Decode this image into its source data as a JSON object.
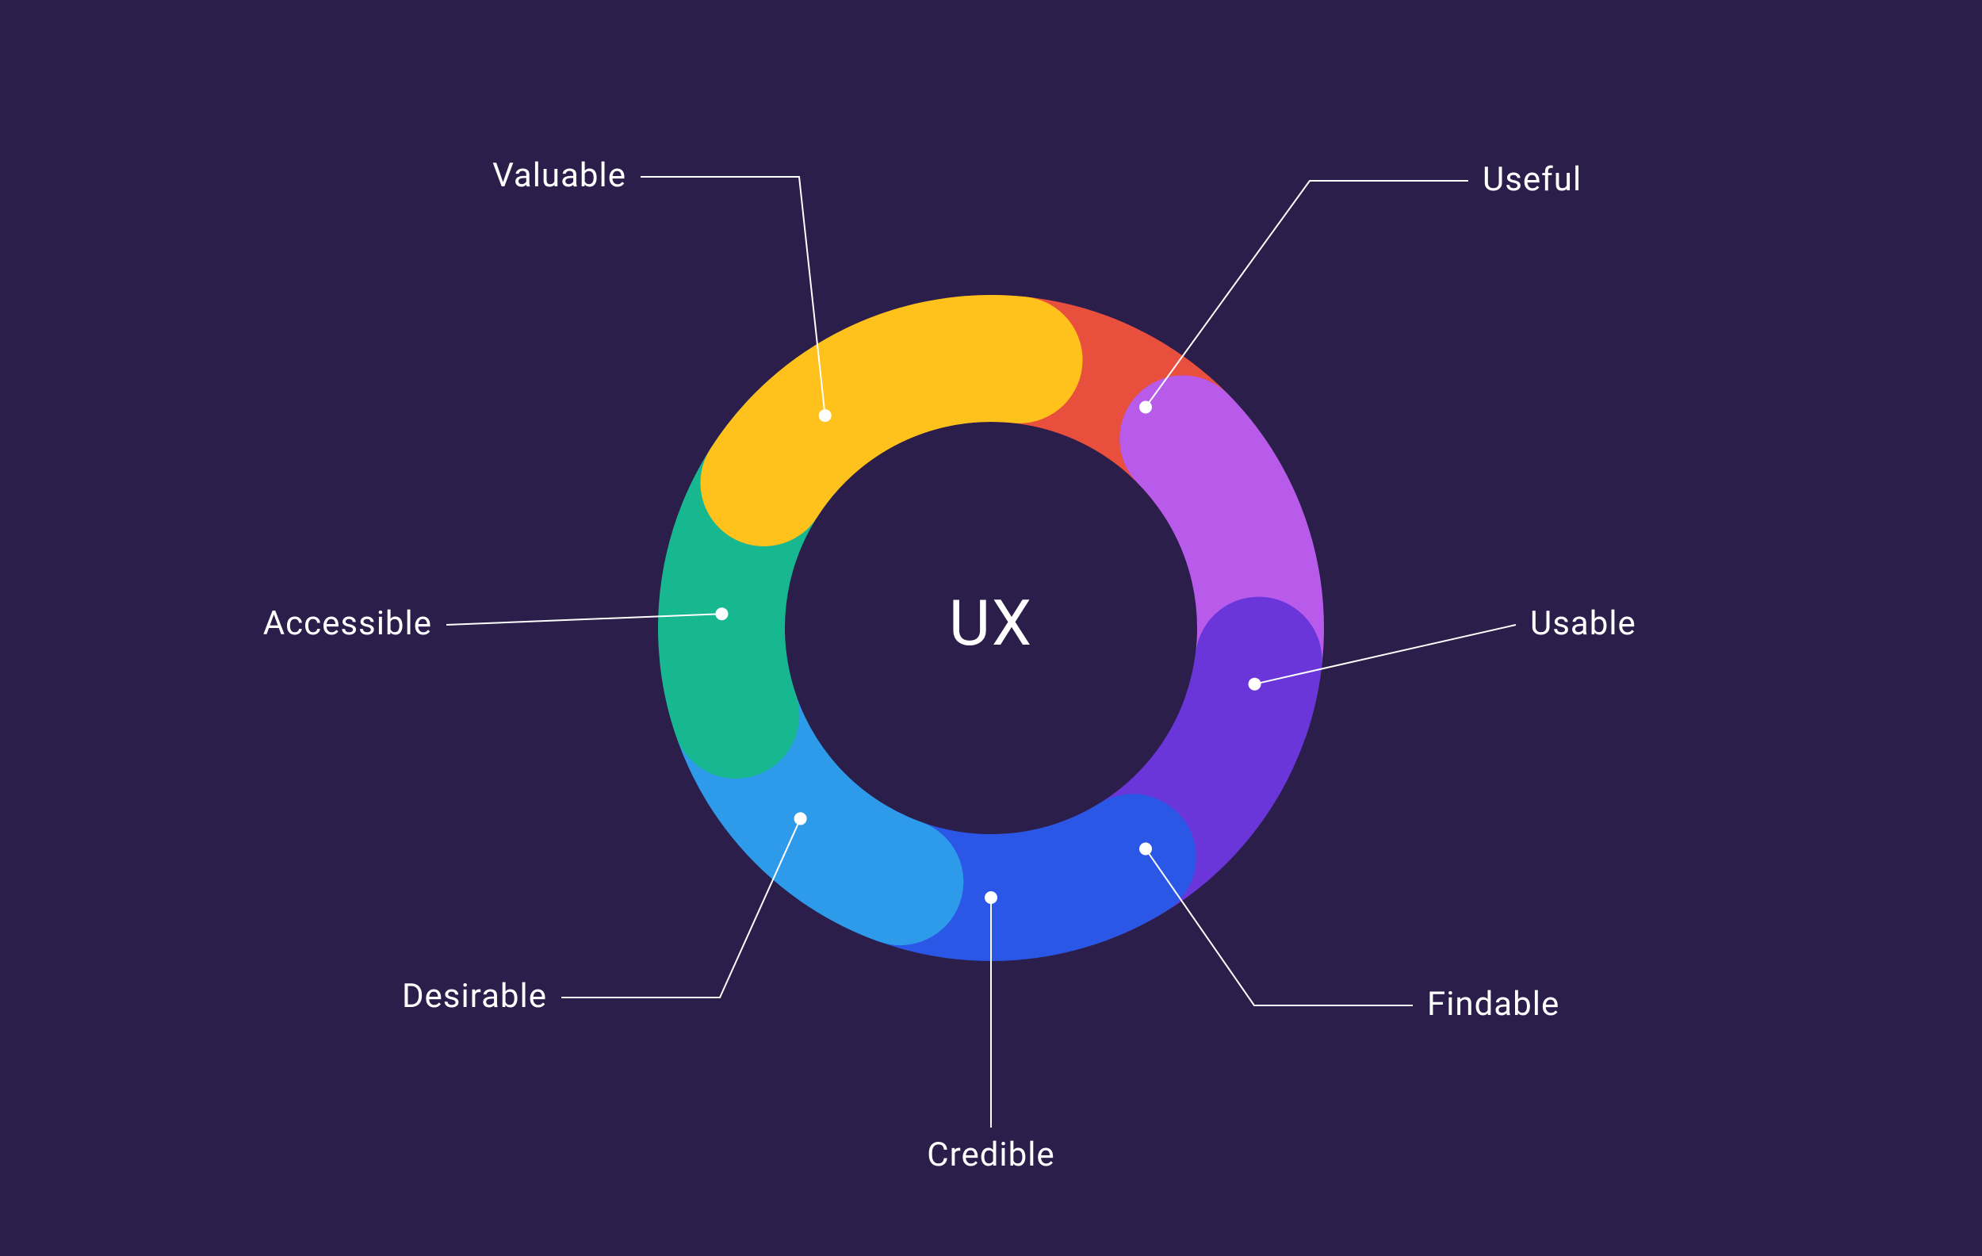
{
  "chart_data": {
    "type": "pie",
    "title": "UX",
    "series": [
      {
        "name": "Useful",
        "value": 1,
        "color": "#e84f3d"
      },
      {
        "name": "Usable",
        "value": 1,
        "color": "#b85beb"
      },
      {
        "name": "Findable",
        "value": 1,
        "color": "#6a36d9"
      },
      {
        "name": "Credible",
        "value": 1,
        "color": "#2b57e6"
      },
      {
        "name": "Desirable",
        "value": 1,
        "color": "#2e9bea"
      },
      {
        "name": "Accessible",
        "value": 1,
        "color": "#17b890"
      },
      {
        "name": "Valuable",
        "value": 1,
        "color": "#ffc21c"
      }
    ]
  },
  "center_label": "UX",
  "segments": {
    "useful": {
      "label": "Useful"
    },
    "usable": {
      "label": "Usable"
    },
    "findable": {
      "label": "Findable"
    },
    "credible": {
      "label": "Credible"
    },
    "desirable": {
      "label": "Desirable"
    },
    "accessible": {
      "label": "Accessible"
    },
    "valuable": {
      "label": "Valuable"
    }
  },
  "colors": {
    "background": "#2b1e4a",
    "useful": "#e84f3d",
    "usable": "#b85beb",
    "findable": "#6a36d9",
    "credible": "#2b57e6",
    "desirable": "#2e9bea",
    "accessible": "#17b890",
    "valuable": "#ffc21c",
    "text": "#ffffff"
  }
}
